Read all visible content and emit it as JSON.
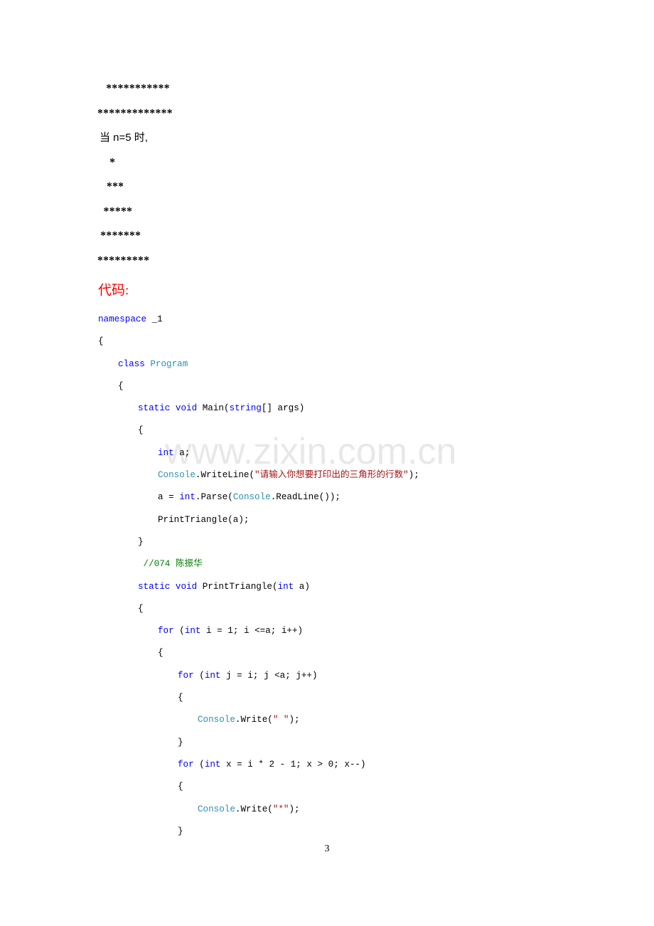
{
  "page": {
    "number": "3",
    "watermark": "www.zixin.com.cn"
  },
  "output_sample": {
    "lines": [
      " ***********",
      "*************"
    ]
  },
  "note": {
    "text": "当 n=5 时,"
  },
  "triangle_sample": {
    "lines": [
      "    *",
      "   ***",
      "  *****",
      " *******",
      "*********"
    ]
  },
  "code_heading": {
    "label": "代码:"
  },
  "code": {
    "lines": [
      {
        "indent": 0,
        "tokens": [
          {
            "t": "namespace",
            "c": "kw"
          },
          {
            "t": " _1",
            "c": "plain"
          }
        ]
      },
      {
        "indent": 0,
        "tokens": [
          {
            "t": "{",
            "c": "plain"
          }
        ]
      },
      {
        "indent": 1,
        "tokens": [
          {
            "t": "class",
            "c": "kw"
          },
          {
            "t": " ",
            "c": "plain"
          },
          {
            "t": "Program",
            "c": "typ"
          }
        ]
      },
      {
        "indent": 1,
        "tokens": [
          {
            "t": "{",
            "c": "plain"
          }
        ]
      },
      {
        "indent": 2,
        "tokens": [
          {
            "t": "static",
            "c": "kw"
          },
          {
            "t": " ",
            "c": "plain"
          },
          {
            "t": "void",
            "c": "kw"
          },
          {
            "t": " Main(",
            "c": "plain"
          },
          {
            "t": "string",
            "c": "kw"
          },
          {
            "t": "[] args)",
            "c": "plain"
          }
        ]
      },
      {
        "indent": 2,
        "tokens": [
          {
            "t": "{",
            "c": "plain"
          }
        ]
      },
      {
        "indent": 3,
        "tokens": [
          {
            "t": "int",
            "c": "kw"
          },
          {
            "t": " a;",
            "c": "plain"
          }
        ]
      },
      {
        "indent": 3,
        "tokens": [
          {
            "t": "Console",
            "c": "typ"
          },
          {
            "t": ".WriteLine(",
            "c": "plain"
          },
          {
            "t": "\"请输入你想要打印出的三角形的行数\"",
            "c": "str"
          },
          {
            "t": ");",
            "c": "plain"
          }
        ]
      },
      {
        "indent": 3,
        "tokens": [
          {
            "t": "a = ",
            "c": "plain"
          },
          {
            "t": "int",
            "c": "kw"
          },
          {
            "t": ".Parse(",
            "c": "plain"
          },
          {
            "t": "Console",
            "c": "typ"
          },
          {
            "t": ".ReadLine());",
            "c": "plain"
          }
        ]
      },
      {
        "indent": 3,
        "tokens": [
          {
            "t": "PrintTriangle(a);",
            "c": "plain"
          }
        ]
      },
      {
        "indent": 2,
        "tokens": [
          {
            "t": "}",
            "c": "plain"
          }
        ]
      },
      {
        "indent": 2,
        "tokens": [
          {
            "t": " //074 陈振华",
            "c": "cmt"
          }
        ]
      },
      {
        "indent": 2,
        "tokens": [
          {
            "t": "static",
            "c": "kw"
          },
          {
            "t": " ",
            "c": "plain"
          },
          {
            "t": "void",
            "c": "kw"
          },
          {
            "t": " PrintTriangle(",
            "c": "plain"
          },
          {
            "t": "int",
            "c": "kw"
          },
          {
            "t": " a)",
            "c": "plain"
          }
        ]
      },
      {
        "indent": 2,
        "tokens": [
          {
            "t": "{",
            "c": "plain"
          }
        ]
      },
      {
        "indent": 3,
        "tokens": [
          {
            "t": "for",
            "c": "kw"
          },
          {
            "t": " (",
            "c": "plain"
          },
          {
            "t": "int",
            "c": "kw"
          },
          {
            "t": " i = 1; i <=a; i++)",
            "c": "plain"
          }
        ]
      },
      {
        "indent": 3,
        "tokens": [
          {
            "t": "{",
            "c": "plain"
          }
        ]
      },
      {
        "indent": 4,
        "tokens": [
          {
            "t": "for",
            "c": "kw"
          },
          {
            "t": " (",
            "c": "plain"
          },
          {
            "t": "int",
            "c": "kw"
          },
          {
            "t": " j = i; j <a; j++)",
            "c": "plain"
          }
        ]
      },
      {
        "indent": 4,
        "tokens": [
          {
            "t": "{",
            "c": "plain"
          }
        ]
      },
      {
        "indent": 5,
        "tokens": [
          {
            "t": "Console",
            "c": "typ"
          },
          {
            "t": ".Write(",
            "c": "plain"
          },
          {
            "t": "\" \"",
            "c": "str"
          },
          {
            "t": ");",
            "c": "plain"
          }
        ]
      },
      {
        "indent": 4,
        "tokens": [
          {
            "t": "}",
            "c": "plain"
          }
        ]
      },
      {
        "indent": 4,
        "tokens": [
          {
            "t": "for",
            "c": "kw"
          },
          {
            "t": " (",
            "c": "plain"
          },
          {
            "t": "int",
            "c": "kw"
          },
          {
            "t": " x = i * 2 - 1; x > 0; x--)",
            "c": "plain"
          }
        ]
      },
      {
        "indent": 4,
        "tokens": [
          {
            "t": "{",
            "c": "plain"
          }
        ]
      },
      {
        "indent": 5,
        "tokens": [
          {
            "t": "Console",
            "c": "typ"
          },
          {
            "t": ".Write(",
            "c": "plain"
          },
          {
            "t": "\"*\"",
            "c": "str"
          },
          {
            "t": ");",
            "c": "plain"
          }
        ]
      },
      {
        "indent": 4,
        "tokens": [
          {
            "t": "}",
            "c": "plain"
          }
        ]
      }
    ]
  },
  "colors": {
    "keyword": "#0000ff",
    "type": "#2b91af",
    "string": "#a31515",
    "comment": "#008000",
    "heading": "#ff0000",
    "watermark": "#e8e8e8"
  }
}
